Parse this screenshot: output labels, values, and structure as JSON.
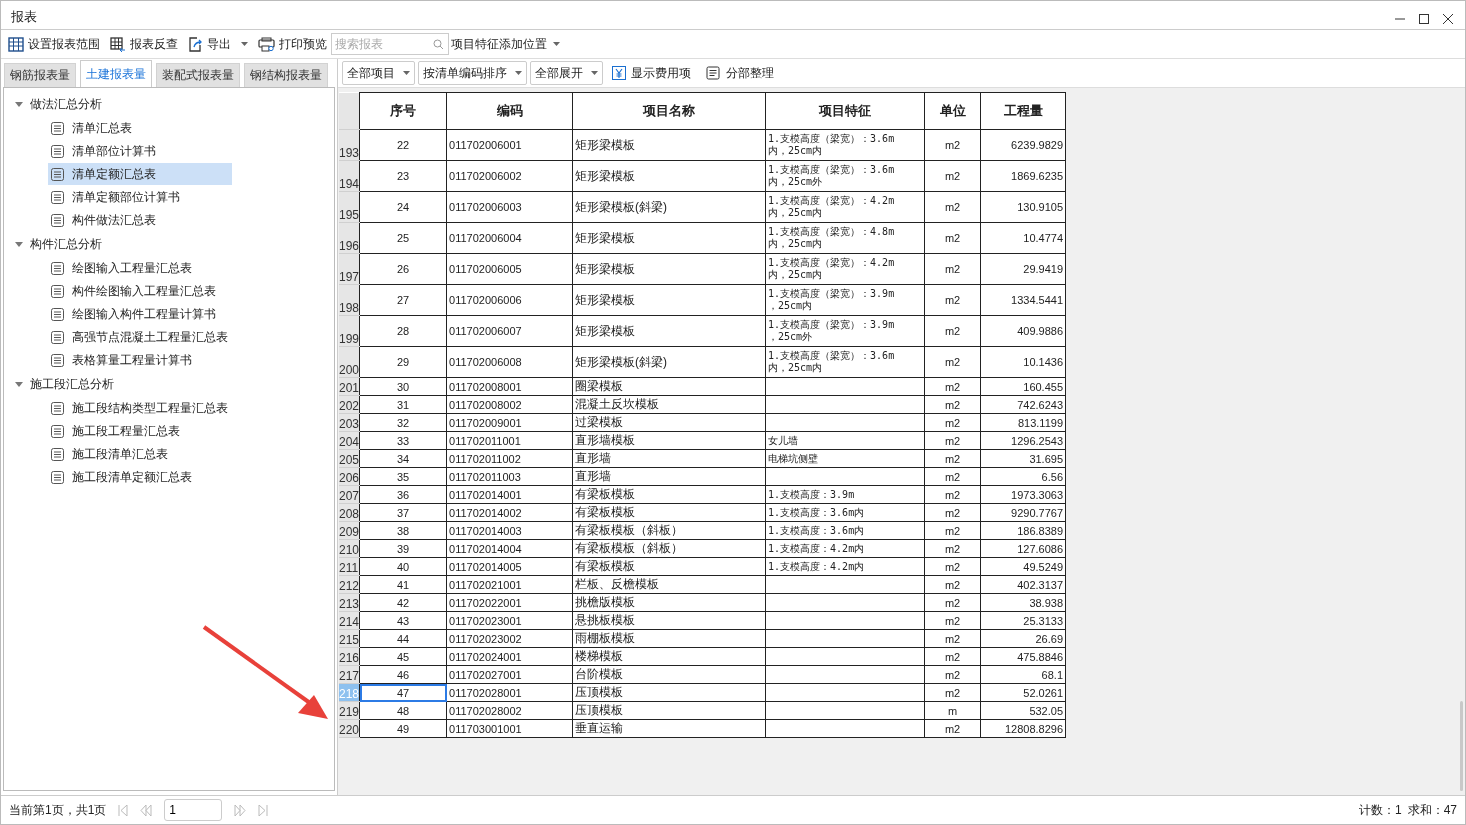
{
  "window": {
    "title": "报表"
  },
  "toolbar": [
    {
      "kind": "range",
      "label": "设置报表范围",
      "dropdown": false
    },
    {
      "kind": "lookup",
      "label": "报表反查",
      "dropdown": false
    },
    {
      "kind": "export",
      "label": "导出",
      "dropdown": true
    },
    {
      "kind": "print",
      "label": "打印预览",
      "dropdown": false
    }
  ],
  "search": {
    "placeholder": "搜索报表"
  },
  "position_dropdown": {
    "label": "项目特征添加位置"
  },
  "tabs": [
    {
      "label": "钢筋报表量",
      "selected": false
    },
    {
      "label": "土建报表量",
      "selected": true
    },
    {
      "label": "装配式报表量",
      "selected": false
    },
    {
      "label": "钢结构报表量",
      "selected": false
    }
  ],
  "tree": [
    {
      "label": "做法汇总分析",
      "expanded": true,
      "children": [
        {
          "label": "清单汇总表",
          "selected": false
        },
        {
          "label": "清单部位计算书",
          "selected": false
        },
        {
          "label": "清单定额汇总表",
          "selected": true
        },
        {
          "label": "清单定额部位计算书",
          "selected": false
        },
        {
          "label": "构件做法汇总表",
          "selected": false
        }
      ]
    },
    {
      "label": "构件汇总分析",
      "expanded": true,
      "children": [
        {
          "label": "绘图输入工程量汇总表",
          "selected": false
        },
        {
          "label": "构件绘图输入工程量汇总表",
          "selected": false
        },
        {
          "label": "绘图输入构件工程量计算书",
          "selected": false
        },
        {
          "label": "高强节点混凝土工程量汇总表",
          "selected": false
        },
        {
          "label": "表格算量工程量计算书",
          "selected": false
        }
      ]
    },
    {
      "label": "施工段汇总分析",
      "expanded": true,
      "children": [
        {
          "label": "施工段结构类型工程量汇总表",
          "selected": false
        },
        {
          "label": "施工段工程量汇总表",
          "selected": false
        },
        {
          "label": "施工段清单汇总表",
          "selected": false
        },
        {
          "label": "施工段清单定额汇总表",
          "selected": false
        }
      ]
    }
  ],
  "filters": [
    {
      "kind": "dropdown",
      "label": "全部项目"
    },
    {
      "kind": "dropdown",
      "label": "按清单编码排序"
    },
    {
      "kind": "dropdown",
      "label": "全部展开"
    },
    {
      "kind": "fee",
      "label": "显示费用项"
    },
    {
      "kind": "tidy",
      "label": "分部整理"
    }
  ],
  "table": {
    "columns": [
      "序号",
      "编码",
      "项目名称",
      "项目特征",
      "单位",
      "工程量"
    ],
    "rows": [
      {
        "row": "193",
        "seq": "22",
        "code": "011702006001",
        "name": "矩形梁模板",
        "feature": [
          "1.支模高度（梁宽）：3.6m",
          "内，25cm内"
        ],
        "unit": "m2",
        "qty": "6239.9829",
        "selected": false
      },
      {
        "row": "194",
        "seq": "23",
        "code": "011702006002",
        "name": "矩形梁模板",
        "feature": [
          "1.支模高度（梁宽）：3.6m",
          "内，25cm外"
        ],
        "unit": "m2",
        "qty": "1869.6235",
        "selected": false
      },
      {
        "row": "195",
        "seq": "24",
        "code": "011702006003",
        "name": "矩形梁模板(斜梁)",
        "feature": [
          "1.支模高度（梁宽）：4.2m",
          "内，25cm内"
        ],
        "unit": "m2",
        "qty": "130.9105",
        "selected": false
      },
      {
        "row": "196",
        "seq": "25",
        "code": "011702006004",
        "name": "矩形梁模板",
        "feature": [
          "1.支模高度（梁宽）：4.8m",
          "内，25cm内"
        ],
        "unit": "m2",
        "qty": "10.4774",
        "selected": false
      },
      {
        "row": "197",
        "seq": "26",
        "code": "011702006005",
        "name": "矩形梁模板",
        "feature": [
          "1.支模高度（梁宽）：4.2m",
          "内，25cm内"
        ],
        "unit": "m2",
        "qty": "29.9419",
        "selected": false
      },
      {
        "row": "198",
        "seq": "27",
        "code": "011702006006",
        "name": "矩形梁模板",
        "feature": [
          "1.支模高度（梁宽）：3.9m",
          "，25cm内"
        ],
        "unit": "m2",
        "qty": "1334.5441",
        "selected": false
      },
      {
        "row": "199",
        "seq": "28",
        "code": "011702006007",
        "name": "矩形梁模板",
        "feature": [
          "1.支模高度（梁宽）：3.9m",
          "，25cm外"
        ],
        "unit": "m2",
        "qty": "409.9886",
        "selected": false
      },
      {
        "row": "200",
        "seq": "29",
        "code": "011702006008",
        "name": "矩形梁模板(斜梁)",
        "feature": [
          "1.支模高度（梁宽）：3.6m",
          "内，25cm内"
        ],
        "unit": "m2",
        "qty": "10.1436",
        "selected": false
      },
      {
        "row": "201",
        "seq": "30",
        "code": "011702008001",
        "name": "圈梁模板",
        "feature": [],
        "unit": "m2",
        "qty": "160.455",
        "selected": false
      },
      {
        "row": "202",
        "seq": "31",
        "code": "011702008002",
        "name": "混凝土反坎模板",
        "feature": [],
        "unit": "m2",
        "qty": "742.6243",
        "selected": false
      },
      {
        "row": "203",
        "seq": "32",
        "code": "011702009001",
        "name": "过梁模板",
        "feature": [],
        "unit": "m2",
        "qty": "813.1199",
        "selected": false
      },
      {
        "row": "204",
        "seq": "33",
        "code": "011702011001",
        "name": "直形墙模板",
        "feature": [
          "女儿墙"
        ],
        "unit": "m2",
        "qty": "1296.2543",
        "selected": false
      },
      {
        "row": "205",
        "seq": "34",
        "code": "011702011002",
        "name": "直形墙",
        "feature": [
          "电梯坑侧壁"
        ],
        "unit": "m2",
        "qty": "31.695",
        "selected": false
      },
      {
        "row": "206",
        "seq": "35",
        "code": "011702011003",
        "name": "直形墙",
        "feature": [],
        "unit": "m2",
        "qty": "6.56",
        "selected": false
      },
      {
        "row": "207",
        "seq": "36",
        "code": "011702014001",
        "name": "有梁板模板",
        "feature": [
          "1.支模高度：3.9m"
        ],
        "unit": "m2",
        "qty": "1973.3063",
        "selected": false
      },
      {
        "row": "208",
        "seq": "37",
        "code": "011702014002",
        "name": "有梁板模板",
        "feature": [
          "1.支模高度：3.6m内"
        ],
        "unit": "m2",
        "qty": "9290.7767",
        "selected": false
      },
      {
        "row": "209",
        "seq": "38",
        "code": "011702014003",
        "name": "有梁板模板（斜板）",
        "feature": [
          "1.支模高度：3.6m内"
        ],
        "unit": "m2",
        "qty": "186.8389",
        "selected": false
      },
      {
        "row": "210",
        "seq": "39",
        "code": "011702014004",
        "name": "有梁板模板（斜板）",
        "feature": [
          "1.支模高度：4.2m内"
        ],
        "unit": "m2",
        "qty": "127.6086",
        "selected": false
      },
      {
        "row": "211",
        "seq": "40",
        "code": "011702014005",
        "name": "有梁板模板",
        "feature": [
          "1.支模高度：4.2m内"
        ],
        "unit": "m2",
        "qty": "49.5249",
        "selected": false
      },
      {
        "row": "212",
        "seq": "41",
        "code": "011702021001",
        "name": "栏板、反檐模板",
        "feature": [],
        "unit": "m2",
        "qty": "402.3137",
        "selected": false
      },
      {
        "row": "213",
        "seq": "42",
        "code": "011702022001",
        "name": "挑檐版模板",
        "feature": [],
        "unit": "m2",
        "qty": "38.938",
        "selected": false
      },
      {
        "row": "214",
        "seq": "43",
        "code": "011702023001",
        "name": "悬挑板模板",
        "feature": [],
        "unit": "m2",
        "qty": "25.3133",
        "selected": false
      },
      {
        "row": "215",
        "seq": "44",
        "code": "011702023002",
        "name": "雨棚板模板",
        "feature": [],
        "unit": "m2",
        "qty": "26.69",
        "selected": false
      },
      {
        "row": "216",
        "seq": "45",
        "code": "011702024001",
        "name": "楼梯模板",
        "feature": [],
        "unit": "m2",
        "qty": "475.8846",
        "selected": false
      },
      {
        "row": "217",
        "seq": "46",
        "code": "011702027001",
        "name": "台阶模板",
        "feature": [],
        "unit": "m2",
        "qty": "68.1",
        "selected": false
      },
      {
        "row": "218",
        "seq": "47",
        "code": "011702028001",
        "name": "压顶模板",
        "feature": [],
        "unit": "m2",
        "qty": "52.0261",
        "selected": true
      },
      {
        "row": "219",
        "seq": "48",
        "code": "011702028002",
        "name": "压顶模板",
        "feature": [],
        "unit": "m",
        "qty": "532.05",
        "selected": false
      },
      {
        "row": "220",
        "seq": "49",
        "code": "011703001001",
        "name": "垂直运输",
        "feature": [],
        "unit": "m2",
        "qty": "12808.8296",
        "selected": false
      }
    ]
  },
  "status_bar": {
    "page_info": "当前第1页，共1页",
    "page_value": "1",
    "count": "计数：1",
    "sum": "求和：47"
  }
}
